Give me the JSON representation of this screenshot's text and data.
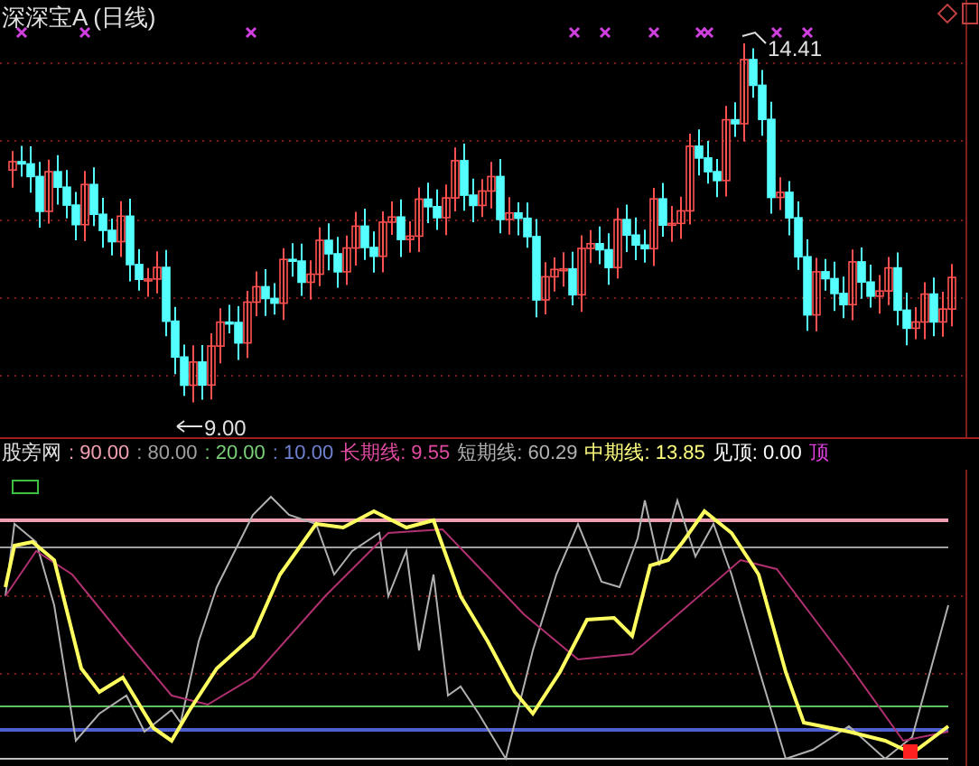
{
  "chart_header": {
    "title": "深深宝A (日线)"
  },
  "price_labels": [
    {
      "kind": "high",
      "text": "14.41"
    },
    {
      "kind": "low",
      "text": "9.00"
    }
  ],
  "indicator_legend": [
    {
      "text": "股旁网",
      "color": "#e0e0e0"
    },
    {
      "text": ": 90.00",
      "color": "#f0a0b0"
    },
    {
      "text": ": 80.00",
      "color": "#a0a0a0"
    },
    {
      "text": ": 20.00",
      "color": "#7ad07a"
    },
    {
      "text": ": 10.00",
      "color": "#7080d0"
    },
    {
      "text": "长期线: 9.55",
      "color": "#e04aa0"
    },
    {
      "text": "短期线: 60.29",
      "color": "#b0b0b0"
    },
    {
      "text": "中期线: 13.85",
      "color": "#ffff80"
    },
    {
      "text": "见顶: 0.00",
      "color": "#ffffff"
    },
    {
      "text": "顶",
      "color": "#e040e0"
    }
  ]
}
